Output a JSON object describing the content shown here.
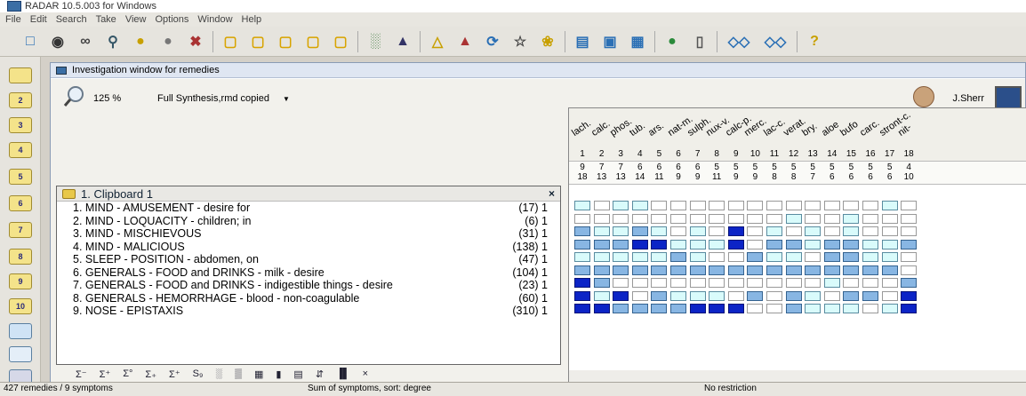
{
  "app": {
    "title": "RADAR 10.5.003 for Windows"
  },
  "menu": [
    "File",
    "Edit",
    "Search",
    "Take",
    "View",
    "Options",
    "Window",
    "Help"
  ],
  "window": {
    "title": "Investigation window for remedies",
    "zoom": "125 %",
    "repertory": "Full Synthesis,rmd copied",
    "user": "J.Sherr"
  },
  "clipboard": {
    "title": "1.  Clipboard 1",
    "close": "×"
  },
  "symptoms": [
    {
      "text": "1. MIND - AMUSEMENT - desire for",
      "count": "(17) 1"
    },
    {
      "text": "2. MIND - LOQUACITY - children; in",
      "count": "(6) 1"
    },
    {
      "text": "3. MIND - MISCHIEVOUS",
      "count": "(31) 1"
    },
    {
      "text": "4. MIND - MALICIOUS",
      "count": "(138) 1"
    },
    {
      "text": "5. SLEEP - POSITION - abdomen, on",
      "count": "(47) 1"
    },
    {
      "text": "6. GENERALS - FOOD and DRINKS - milk - desire",
      "count": "(104) 1"
    },
    {
      "text": "7. GENERALS - FOOD and DRINKS - indigestible things - desire",
      "count": "(23) 1"
    },
    {
      "text": "8. GENERALS - HEMORRHAGE - blood - non-coagulable",
      "count": "(60) 1"
    },
    {
      "text": "9. NOSE - EPISTAXIS",
      "count": "(310) 1"
    }
  ],
  "remedies": [
    "lach.",
    "calc.",
    "phos.",
    "tub.",
    "ars.",
    "nat-m.",
    "sulph.",
    "nux-v.",
    "calc-p.",
    "merc.",
    "lac-c.",
    "verat.",
    "bry.",
    "aloe",
    "bufo",
    "carc.",
    "stront-c.",
    "nit-"
  ],
  "remedy_numbers": [
    "1",
    "2",
    "3",
    "4",
    "5",
    "6",
    "7",
    "8",
    "9",
    "10",
    "11",
    "12",
    "13",
    "14",
    "15",
    "16",
    "17",
    "18"
  ],
  "symptom_counts": [
    "9",
    "7",
    "7",
    "6",
    "6",
    "6",
    "6",
    "5",
    "5",
    "5",
    "5",
    "5",
    "5",
    "5",
    "5",
    "5",
    "5",
    "4"
  ],
  "degree_sums": [
    "18",
    "13",
    "13",
    "14",
    "11",
    "9",
    "9",
    "11",
    "9",
    "9",
    "8",
    "8",
    "7",
    "6",
    "6",
    "6",
    "6",
    "10"
  ],
  "grid": [
    [
      1,
      0,
      1,
      1,
      0,
      0,
      0,
      0,
      0,
      0,
      0,
      0,
      0,
      0,
      0,
      0,
      1,
      0
    ],
    [
      0,
      0,
      0,
      0,
      0,
      0,
      0,
      0,
      0,
      0,
      0,
      1,
      0,
      0,
      1,
      0,
      0,
      0
    ],
    [
      2,
      1,
      1,
      2,
      1,
      0,
      1,
      0,
      3,
      0,
      1,
      0,
      1,
      0,
      1,
      0,
      0,
      0
    ],
    [
      2,
      2,
      2,
      3,
      3,
      1,
      1,
      1,
      3,
      0,
      2,
      2,
      1,
      2,
      2,
      1,
      1,
      2
    ],
    [
      1,
      1,
      1,
      1,
      1,
      2,
      1,
      0,
      0,
      2,
      1,
      1,
      0,
      2,
      2,
      1,
      1,
      0
    ],
    [
      2,
      2,
      2,
      2,
      2,
      2,
      2,
      2,
      2,
      2,
      2,
      2,
      2,
      2,
      2,
      2,
      2,
      0
    ],
    [
      3,
      2,
      0,
      0,
      0,
      0,
      0,
      0,
      0,
      0,
      0,
      0,
      0,
      1,
      0,
      0,
      0,
      2
    ],
    [
      3,
      1,
      3,
      0,
      2,
      1,
      1,
      1,
      0,
      2,
      0,
      2,
      1,
      0,
      2,
      2,
      0,
      3
    ],
    [
      3,
      3,
      2,
      2,
      2,
      2,
      3,
      3,
      3,
      0,
      0,
      2,
      1,
      1,
      1,
      0,
      1,
      3
    ]
  ],
  "status": {
    "left": "427 remedies / 9 symptoms",
    "middle": "Sum of symptoms, sort: degree",
    "right": "No restriction"
  },
  "colors": {
    "grade1": "#d9fbfb",
    "grade2": "#88b6e3",
    "grade3": "#0c24c6"
  }
}
